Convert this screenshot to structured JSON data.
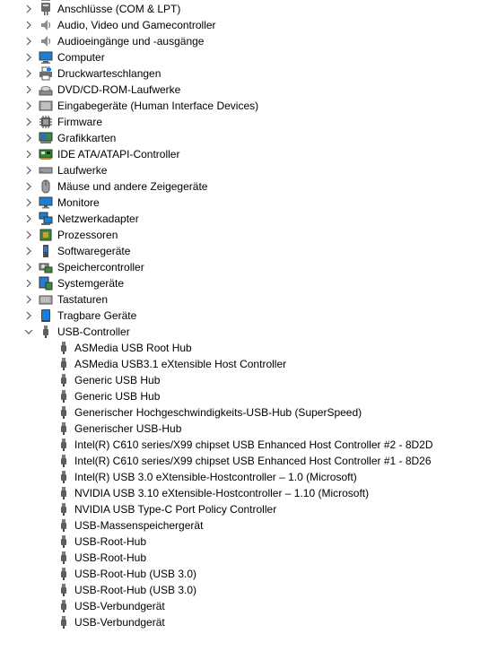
{
  "categories": [
    {
      "label": "Anschlüsse (COM & LPT)",
      "icon": "port-icon",
      "expanded": false
    },
    {
      "label": "Audio, Video und Gamecontroller",
      "icon": "speaker-icon",
      "expanded": false
    },
    {
      "label": "Audioeingänge und -ausgänge",
      "icon": "speaker-icon",
      "expanded": false
    },
    {
      "label": "Computer",
      "icon": "computer-icon",
      "expanded": false
    },
    {
      "label": "Druckwarteschlangen",
      "icon": "printer-icon",
      "expanded": false
    },
    {
      "label": "DVD/CD-ROM-Laufwerke",
      "icon": "disc-drive-icon",
      "expanded": false
    },
    {
      "label": "Eingabegeräte (Human Interface Devices)",
      "icon": "hid-icon",
      "expanded": false
    },
    {
      "label": "Firmware",
      "icon": "chip-icon",
      "expanded": false
    },
    {
      "label": "Grafikkarten",
      "icon": "display-adapter-icon",
      "expanded": false
    },
    {
      "label": "IDE ATA/ATAPI-Controller",
      "icon": "ide-controller-icon",
      "expanded": false
    },
    {
      "label": "Laufwerke",
      "icon": "disk-drive-icon",
      "expanded": false
    },
    {
      "label": "Mäuse und andere Zeigegeräte",
      "icon": "mouse-icon",
      "expanded": false
    },
    {
      "label": "Monitore",
      "icon": "monitor-icon",
      "expanded": false
    },
    {
      "label": "Netzwerkadapter",
      "icon": "network-adapter-icon",
      "expanded": false
    },
    {
      "label": "Prozessoren",
      "icon": "processor-icon",
      "expanded": false
    },
    {
      "label": "Softwaregeräte",
      "icon": "software-device-icon",
      "expanded": false
    },
    {
      "label": "Speichercontroller",
      "icon": "storage-controller-icon",
      "expanded": false
    },
    {
      "label": "Systemgeräte",
      "icon": "system-device-icon",
      "expanded": false
    },
    {
      "label": "Tastaturen",
      "icon": "keyboard-icon",
      "expanded": false
    },
    {
      "label": "Tragbare Geräte",
      "icon": "portable-device-icon",
      "expanded": false
    },
    {
      "label": "USB-Controller",
      "icon": "usb-icon",
      "expanded": true
    }
  ],
  "usb_devices": [
    "ASMedia USB Root Hub",
    "ASMedia USB3.1 eXtensible Host Controller",
    "Generic USB Hub",
    "Generic USB Hub",
    "Generischer Hochgeschwindigkeits-USB-Hub (SuperSpeed)",
    "Generischer USB-Hub",
    "Intel(R) C610 series/X99 chipset USB Enhanced Host Controller #2 - 8D2D",
    "Intel(R) C610 series/X99 chipset USB Enhanced Host Controller #1 - 8D26",
    "Intel(R) USB 3.0 eXtensible-Hostcontroller – 1.0 (Microsoft)",
    "NVIDIA USB 3.10 eXtensible-Hostcontroller – 1.10 (Microsoft)",
    "NVIDIA USB Type-C Port Policy Controller",
    "USB-Massenspeichergerät",
    "USB-Root-Hub",
    "USB-Root-Hub",
    "USB-Root-Hub (USB 3.0)",
    "USB-Root-Hub (USB 3.0)",
    "USB-Verbundgerät",
    "USB-Verbundgerät"
  ]
}
